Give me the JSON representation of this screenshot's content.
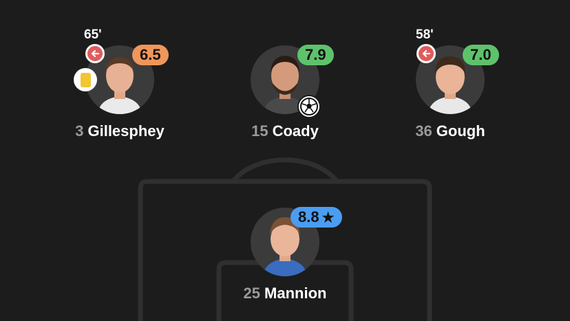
{
  "colors": {
    "background": "#1c1c1c",
    "pitch_line": "#2f2f2f",
    "rating_orange": "#f0965a",
    "rating_green": "#5ec26b",
    "rating_blue": "#4a9df0",
    "sub_off_red": "#e05c5c",
    "yellow_card": "#f2c531",
    "number_grey": "#9a9a9a"
  },
  "players": [
    {
      "number": "3",
      "name": "Gillesphey",
      "rating": "6.5",
      "sub_minute": "65'",
      "icons": [
        "sub-off-icon",
        "yellow-card-icon"
      ]
    },
    {
      "number": "15",
      "name": "Coady",
      "rating": "7.9",
      "icons": [
        "goal-ball-icon"
      ]
    },
    {
      "number": "36",
      "name": "Gough",
      "rating": "7.0",
      "sub_minute": "58'",
      "icons": [
        "sub-off-icon"
      ]
    },
    {
      "number": "25",
      "name": "Mannion",
      "rating": "8.8",
      "icons": [
        "star-icon"
      ],
      "player_of_match": true
    }
  ]
}
